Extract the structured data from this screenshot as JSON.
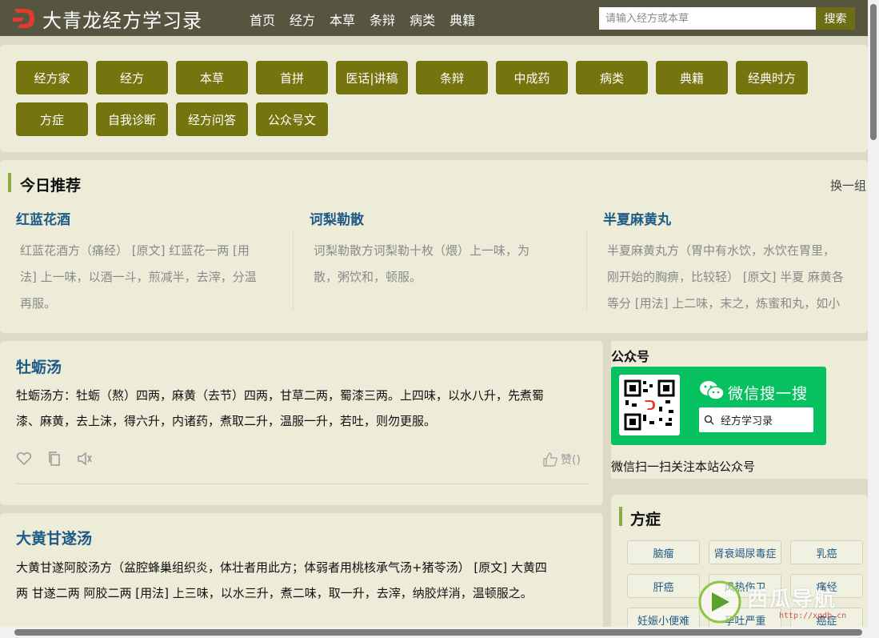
{
  "header": {
    "site_title": "大青龙经方学习录",
    "nav": [
      "首页",
      "经方",
      "本草",
      "条辩",
      "病类",
      "典籍"
    ],
    "search_placeholder": "请输入经方或本草",
    "search_button": "搜索"
  },
  "categories": [
    "经方家",
    "经方",
    "本草",
    "首拼",
    "医话|讲稿",
    "条辩",
    "中成药",
    "病类",
    "典籍",
    "经典时方",
    "方症",
    "自我诊断",
    "经方问答",
    "公众号文"
  ],
  "today": {
    "title": "今日推荐",
    "refresh": "换一组",
    "items": [
      {
        "title": "红蓝花酒",
        "lines": [
          "红蓝花酒方（痛经） [原文] 红蓝花一两 [用",
          "法] 上一味，以酒一斗，煎减半，去滓，分温",
          "再服。"
        ]
      },
      {
        "title": "诃梨勒散",
        "lines": [
          "诃梨勒散方诃梨勒十枚（煨）上一味，为",
          "散，粥饮和，顿服。"
        ]
      },
      {
        "title": "半夏麻黄丸",
        "lines": [
          "半夏麻黄丸方（胃中有水饮，水饮在胃里，",
          "刚开始的胸痹，比较轻） [原文] 半夏 麻黄各",
          "等分 [用法] 上二味，末之，炼蜜和丸，如小"
        ]
      }
    ]
  },
  "articles": [
    {
      "title": "牡蛎汤",
      "lines": [
        "牡蛎汤方：牡蛎（熬）四两，麻黄（去节）四两，甘草二两，蜀漆三两。上四味，以水八升，先煮蜀",
        "漆、麻黄，去上沫，得六升，内诸药，煮取二升，温服一升，若吐，则勿更服。"
      ],
      "like": "赞()"
    },
    {
      "title": "大黄甘遂汤",
      "lines": [
        "大黄甘遂阿胶汤方（盆腔蜂巢组织炎，体壮者用此方；体弱者用桃核承气汤+猪苓汤） [原文] 大黄四",
        "两 甘遂二两 阿胶二两 [用法] 上三味，以水三升，煮二味，取一升，去滓，纳胶烊消，温顿服之。"
      ],
      "like": ""
    }
  ],
  "gzh": {
    "label": "公众号",
    "card_title": "微信搜一搜",
    "card_search": "经方学习录",
    "caption": "微信扫一扫关注本站公众号"
  },
  "fangzheng": {
    "title": "方症",
    "tags": [
      "脑瘤",
      "肾衰竭尿毒症",
      "乳癌",
      "肝癌",
      "风热伤卫",
      "痛经",
      "妊娠小便难",
      "孕吐严重",
      "癌症"
    ]
  },
  "watermark": {
    "text": "西瓜导航",
    "url": "http://xgdh.cn"
  },
  "colors": {
    "header": "#565640",
    "category_button": "#75750f",
    "link": "#1e5a86",
    "accent_bar": "#8dab45",
    "wechat_green": "#07c160"
  }
}
